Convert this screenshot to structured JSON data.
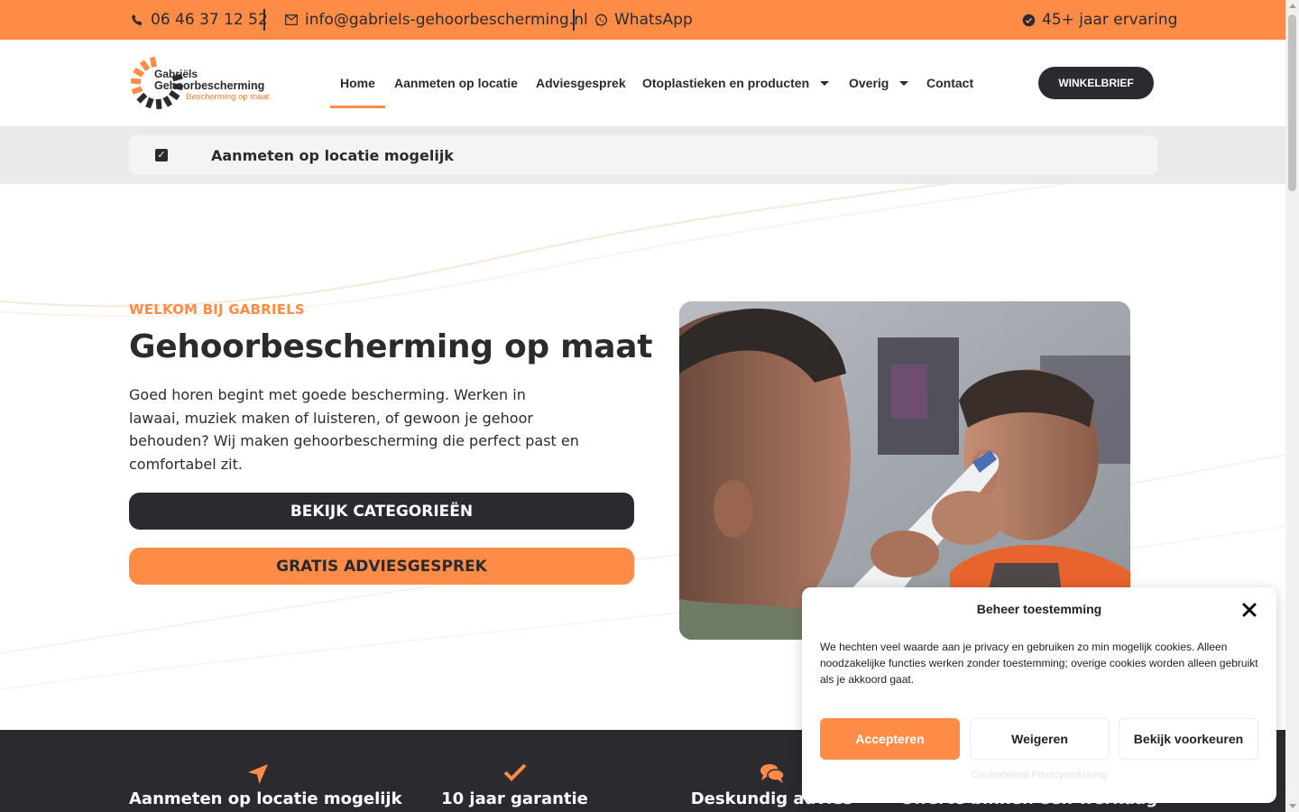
{
  "colors": {
    "accent": "#ff8c46",
    "dark": "#2b2a2e",
    "band": "#eaeaea"
  },
  "topbar": {
    "phone": "06 46 37 12 52",
    "email": "info@gabriels-gehoorbescherming.nl",
    "whatsapp": "WhatsApp",
    "experience": "45+ jaar ervaring"
  },
  "logo": {
    "line1": "Gabriëls",
    "line2": "Gehoorbescherming",
    "tagline": "Bescherming op maat"
  },
  "nav": {
    "items": [
      {
        "label": "Home",
        "active": true
      },
      {
        "label": "Aanmeten op locatie"
      },
      {
        "label": "Adviesgesprek"
      },
      {
        "label": "Otoplastieken en producten",
        "dropdown": true
      },
      {
        "label": "Overig",
        "dropdown": true
      },
      {
        "label": "Contact"
      }
    ],
    "cta": "WINKELBRIEF"
  },
  "notice": {
    "text": "Aanmeten op locatie mogelijk"
  },
  "hero": {
    "eyebrow": "WELKOM BIJ GABRIELS",
    "title": "Gehoorbescherming op maat",
    "lead": "Goed horen begint met goede bescherming. Werken in lawaai, muziek maken of luisteren, of gewoon je gehoor behouden? Wij maken gehoorbescherming die perfect past en comfortabel zit.",
    "primary_button": "BEKIJK CATEGORIEËN",
    "secondary_button": "GRATIS ADVIESGESPREK"
  },
  "features": [
    {
      "icon": "location-arrow-icon",
      "label": "Aanmeten op locatie mogelijk"
    },
    {
      "icon": "checkmark-icon",
      "label": "10 jaar garantie"
    },
    {
      "icon": "chat-bubbles-icon",
      "label": "Deskundig advies"
    },
    {
      "icon": "document-icon",
      "label": "Offerte binnen een werkdag"
    }
  ],
  "cookie": {
    "title": "Beheer toestemming",
    "body": "We hechten veel waarde aan je privacy en gebruiken zo min mogelijk cookies. Alleen noodzakelijke functies werken zonder toestemming; overige cookies worden alleen gebruikt als je akkoord gaat.",
    "accept": "Accepteren",
    "deny": "Weigeren",
    "preferences": "Bekijk voorkeuren",
    "footer": "Cookiebeleid   Privacyverklaring"
  }
}
